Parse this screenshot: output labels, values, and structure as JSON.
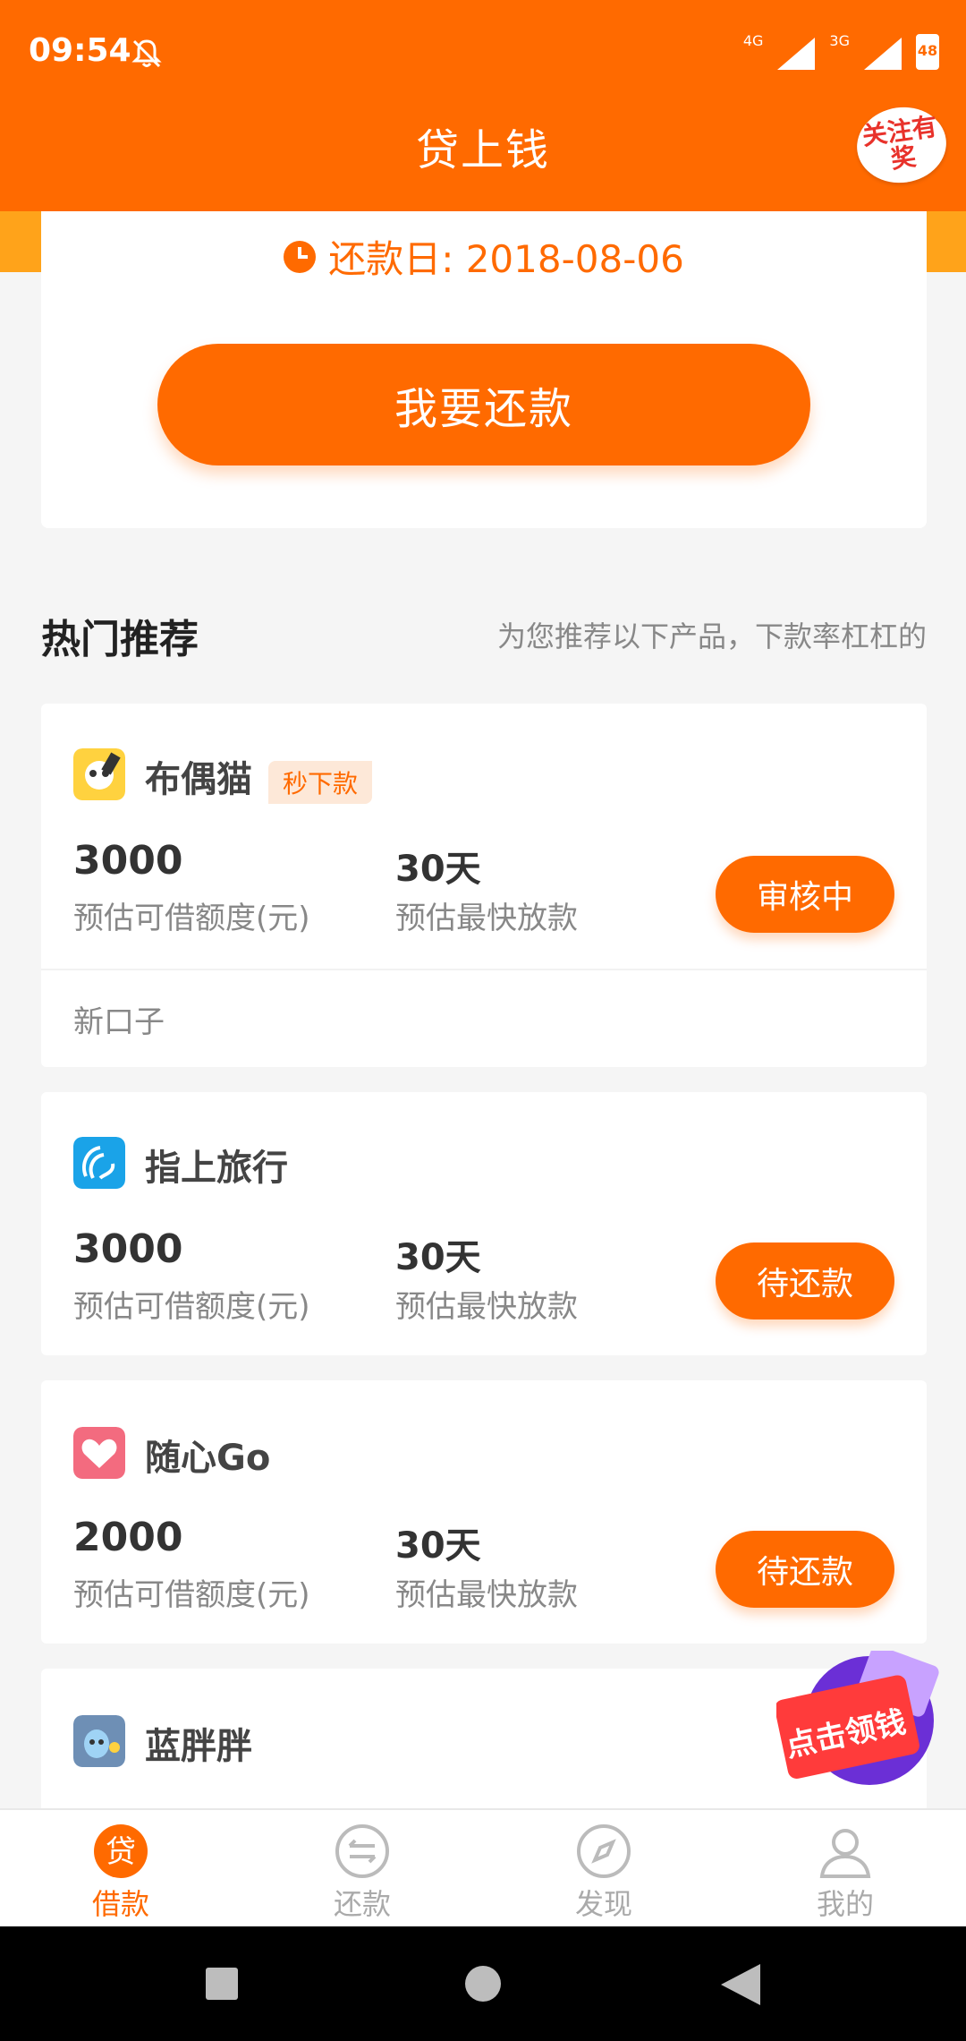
{
  "status_bar": {
    "time": "09:54",
    "network_left": "4G",
    "network_right": "3G",
    "battery": "48"
  },
  "header": {
    "title": "贷上钱",
    "promo_badge": "关注有奖"
  },
  "repay_card": {
    "due_date_text": "还款日: 2018-08-06",
    "button_label": "我要还款"
  },
  "recommend": {
    "title": "热门推荐",
    "subtitle": "为您推荐以下产品，下款率杠杠的"
  },
  "products": [
    {
      "name": "布偶猫",
      "tag": "秒下款",
      "amount": "3000",
      "amount_label": "预估可借额度(元)",
      "days": "30天",
      "days_label": "预估最快放款",
      "action_label": "审核中",
      "note": "新口子",
      "logo_icon": "panda-cat-logo-icon"
    },
    {
      "name": "指上旅行",
      "amount": "3000",
      "amount_label": "预估可借额度(元)",
      "days": "30天",
      "days_label": "预估最快放款",
      "action_label": "待还款",
      "logo_icon": "travel-logo-icon"
    },
    {
      "name": "随心Go",
      "amount": "2000",
      "amount_label": "预估可借额度(元)",
      "days": "30天",
      "days_label": "预估最快放款",
      "action_label": "待还款",
      "logo_icon": "heart-go-logo-icon"
    },
    {
      "name": "蓝胖胖",
      "logo_icon": "blue-mascot-logo-icon"
    }
  ],
  "float_promo": {
    "label": "点击领钱"
  },
  "bottom_nav": {
    "items": [
      {
        "label": "借款",
        "icon": "loan-icon",
        "active": true
      },
      {
        "label": "还款",
        "icon": "repay-icon",
        "active": false
      },
      {
        "label": "发现",
        "icon": "compass-icon",
        "active": false
      },
      {
        "label": "我的",
        "icon": "profile-icon",
        "active": false
      }
    ]
  },
  "colors": {
    "brand_orange": "#ff6a00",
    "strip_orange": "#ffa31a",
    "background": "#f5f5f5"
  }
}
